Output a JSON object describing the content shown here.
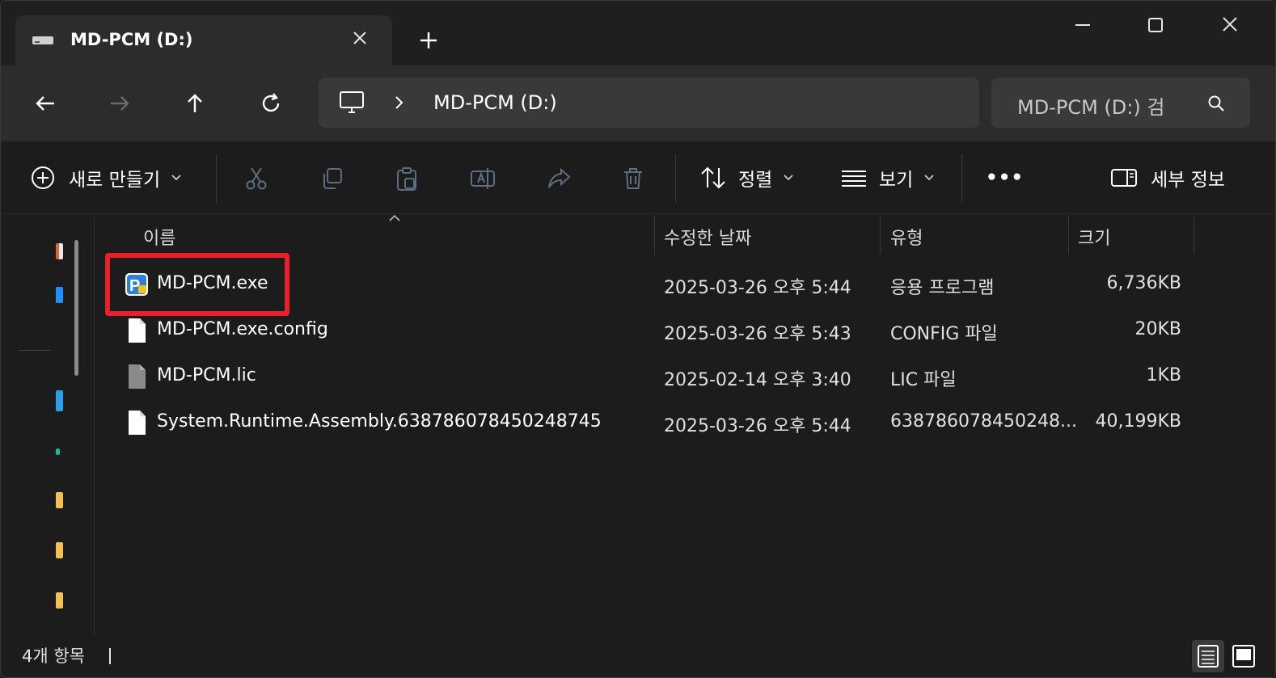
{
  "window": {
    "tab_title": "MD-PCM (D:)",
    "controls": {
      "minimize": "minimize",
      "maximize": "maximize",
      "close": "close"
    }
  },
  "address_bar": {
    "breadcrumb": "MD-PCM (D:)",
    "search_placeholder": "MD-PCM (D:) 검"
  },
  "command_bar": {
    "new_label": "새로 만들기",
    "sort_label": "정렬",
    "view_label": "보기",
    "more_label": "•••",
    "details_pane_label": "세부 정보"
  },
  "columns": {
    "name": "이름",
    "date": "수정한 날짜",
    "type": "유형",
    "size": "크기"
  },
  "files": [
    {
      "name": "MD-PCM.exe",
      "date": "2025-03-26 오후 5:44",
      "type": "응용 프로그램",
      "size": "6,736KB",
      "icon": "app-icon"
    },
    {
      "name": "MD-PCM.exe.config",
      "date": "2025-03-26 오후 5:43",
      "type": "CONFIG 파일",
      "size": "20KB",
      "icon": "document-icon"
    },
    {
      "name": "MD-PCM.lic",
      "date": "2025-02-14 오후 3:40",
      "type": "LIC 파일",
      "size": "1KB",
      "icon": "document-gray-icon"
    },
    {
      "name": "System.Runtime.Assembly.638786078450248745",
      "date": "2025-03-26 오후 5:44",
      "type": "638786078450248...",
      "size": "40,199KB",
      "icon": "document-icon"
    }
  ],
  "status": {
    "item_count": "4개 항목"
  },
  "colors": {
    "highlight": "#e8212a",
    "background": "#1c1c1c",
    "toolbar": "#2c2c2c"
  }
}
